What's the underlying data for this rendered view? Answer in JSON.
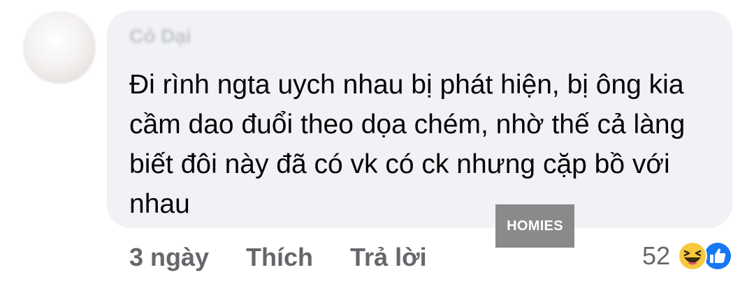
{
  "comment": {
    "author": "Cỏ Dại",
    "text": "Đi rình ngta uych nhau bị phát hiện, bị ông kia cầm dao đuổi theo dọa chém, nhờ thế cả làng biết đôi này đã có vk có ck nhưng cặp bồ với nhau",
    "time": "3 ngày",
    "like_label": "Thích",
    "reply_label": "Trả lời",
    "reaction_count": "52",
    "reactions": [
      "haha-icon",
      "like-icon"
    ]
  },
  "watermark": {
    "text": "HOMIES"
  },
  "colors": {
    "bubble_bg": "#f0f2f5",
    "text": "#050505",
    "secondary_text": "#65676b",
    "like_blue": "#1877f2",
    "haha_yellow": "#f7c93d"
  }
}
